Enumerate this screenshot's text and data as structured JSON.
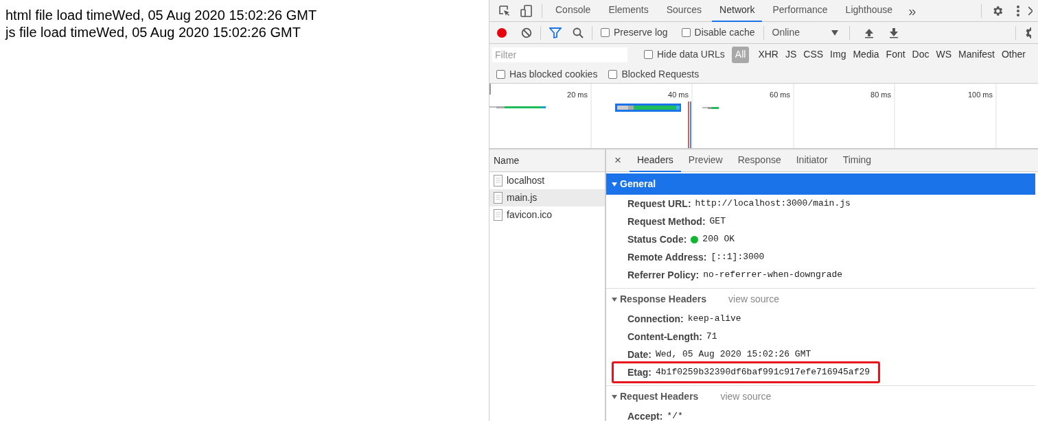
{
  "page": {
    "lines": [
      "html file load timeWed, 05 Aug 2020 15:02:26 GMT",
      "js file load timeWed, 05 Aug 2020 15:02:26 GMT"
    ]
  },
  "devtools": {
    "panel_tabs": [
      {
        "label": "Console",
        "selected": false
      },
      {
        "label": "Elements",
        "selected": false
      },
      {
        "label": "Sources",
        "selected": false
      },
      {
        "label": "Network",
        "selected": true
      },
      {
        "label": "Performance",
        "selected": false
      },
      {
        "label": "Lighthouse",
        "selected": false
      }
    ],
    "more_tabs": "»",
    "toolbar": {
      "recording": true,
      "filter_active": true,
      "preserve_log": {
        "label": "Preserve log",
        "checked": false
      },
      "disable_cache": {
        "label": "Disable cache",
        "checked": false
      },
      "throttling": "Online"
    },
    "filter": {
      "placeholder": "Filter",
      "hide_data_urls": {
        "label": "Hide data URLs",
        "checked": false
      },
      "types": [
        {
          "label": "All",
          "selected": true
        },
        {
          "label": "XHR",
          "selected": false
        },
        {
          "label": "JS",
          "selected": false
        },
        {
          "label": "CSS",
          "selected": false
        },
        {
          "label": "Img",
          "selected": false
        },
        {
          "label": "Media",
          "selected": false
        },
        {
          "label": "Font",
          "selected": false
        },
        {
          "label": "Doc",
          "selected": false
        },
        {
          "label": "WS",
          "selected": false
        },
        {
          "label": "Manifest",
          "selected": false
        },
        {
          "label": "Other",
          "selected": false
        }
      ],
      "has_blocked_cookies": {
        "label": "Has blocked cookies",
        "checked": false
      },
      "blocked_requests": {
        "label": "Blocked Requests",
        "checked": false
      }
    },
    "timeline": {
      "ticks": [
        "20 ms",
        "40 ms",
        "60 ms",
        "80 ms",
        "100 ms"
      ]
    },
    "requests": {
      "column": "Name",
      "rows": [
        {
          "name": "localhost",
          "selected": false
        },
        {
          "name": "main.js",
          "selected": true
        },
        {
          "name": "favicon.ico",
          "selected": false
        }
      ]
    },
    "close": "×",
    "detail_tabs": [
      {
        "label": "Headers",
        "selected": true
      },
      {
        "label": "Preview",
        "selected": false
      },
      {
        "label": "Response",
        "selected": false
      },
      {
        "label": "Initiator",
        "selected": false
      },
      {
        "label": "Timing",
        "selected": false
      }
    ],
    "sections": [
      {
        "title": "General",
        "selected": true,
        "expanded": true,
        "rows": [
          {
            "key": "Request URL:",
            "value": "http://localhost:3000/main.js",
            "highlighted": false
          },
          {
            "key": "Request Method:",
            "value": "GET",
            "highlighted": false
          },
          {
            "key": "Status Code:",
            "value": "200 OK",
            "color": "#12b631",
            "highlighted": false
          },
          {
            "key": "Remote Address:",
            "value": "[::1]:3000",
            "highlighted": false
          },
          {
            "key": "Referrer Policy:",
            "value": "no-referrer-when-downgrade",
            "highlighted": false
          }
        ]
      },
      {
        "title": "Response Headers",
        "selected": false,
        "expanded": true,
        "view_source": "view source",
        "rows": [
          {
            "key": "Connection:",
            "value": "keep-alive",
            "highlighted": false
          },
          {
            "key": "Content-Length:",
            "value": "71",
            "highlighted": false
          },
          {
            "key": "Date:",
            "value": "Wed, 05 Aug 2020 15:02:26 GMT",
            "highlighted": false
          },
          {
            "key": "Etag:",
            "value": "4b1f0259b32390df6baf991c917efe716945af29",
            "highlighted": true
          }
        ]
      },
      {
        "title": "Request Headers",
        "selected": false,
        "expanded": true,
        "view_source": "view source",
        "rows": [
          {
            "key": "Accept:",
            "value": "*/*",
            "highlighted": false
          }
        ]
      }
    ]
  }
}
